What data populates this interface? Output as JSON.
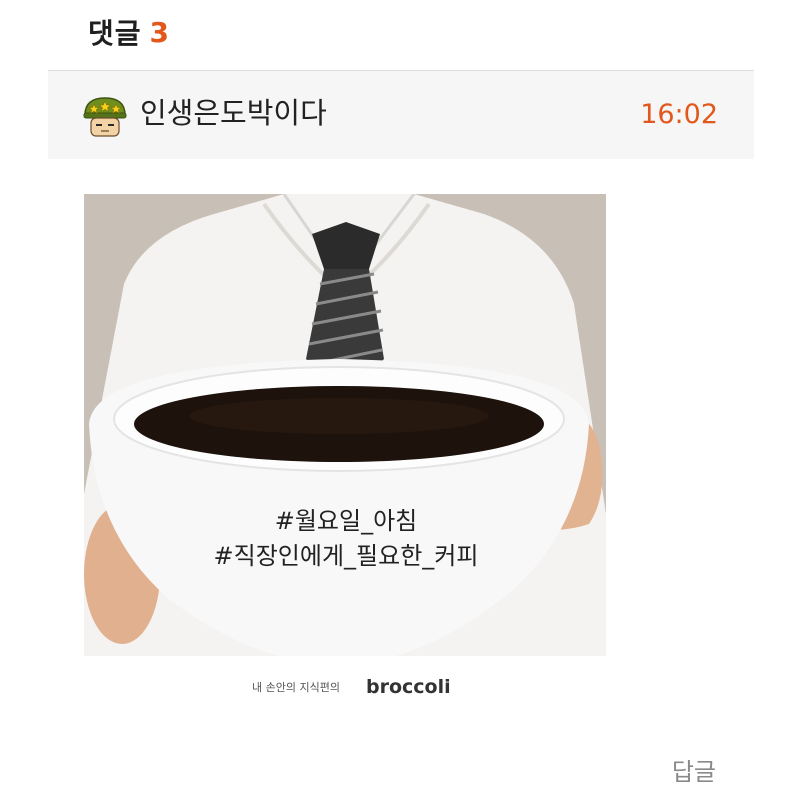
{
  "comments": {
    "title": "댓글",
    "count": "3"
  },
  "comment": {
    "author": "인생은도박이다",
    "time": "16:02",
    "avatar_icon": "military-helmet-stars-avatar",
    "image": {
      "hashtags": [
        "#월요일_아침",
        "#직장인에게_필요한_커피"
      ],
      "caption_small": "내 손안의 지식편의",
      "caption_brand": "broccoli"
    },
    "reply_label": "답글"
  },
  "colors": {
    "accent": "#e2581c",
    "bar_bg": "#f6f6f6",
    "muted": "#8a8a8a"
  }
}
